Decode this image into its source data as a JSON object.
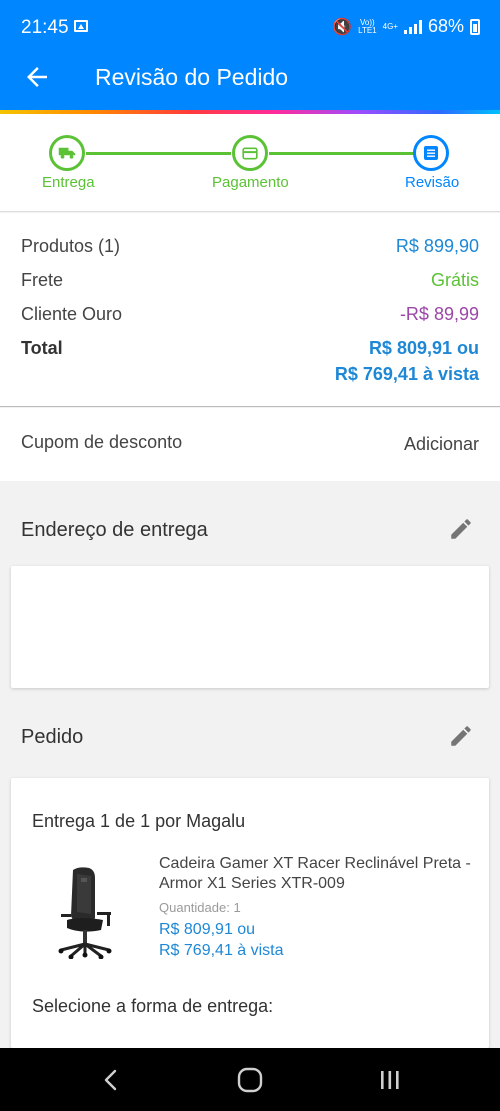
{
  "status_bar": {
    "time": "21:45",
    "network_top": "Vo))",
    "network_bottom": "LTE1",
    "network_gen": "4G+",
    "battery": "68%"
  },
  "header": {
    "title": "Revisão do Pedido",
    "back_icon": "arrow-left-icon"
  },
  "stepper": {
    "steps": [
      {
        "label": "Entrega",
        "icon": "truck-icon",
        "state": "done"
      },
      {
        "label": "Pagamento",
        "icon": "card-icon",
        "state": "done"
      },
      {
        "label": "Revisão",
        "icon": "list-icon",
        "state": "current"
      }
    ],
    "colors": {
      "done": "#5bc236",
      "current": "#0086ff"
    }
  },
  "summary": {
    "products_label": "Produtos (1)",
    "products_value": "R$ 899,90",
    "shipping_label": "Frete",
    "shipping_value": "Grátis",
    "gold_label": "Cliente Ouro",
    "gold_value": "-R$ 89,99",
    "total_label": "Total",
    "total_value_1": "R$ 809,91 ou",
    "total_value_2": "R$ 769,41 à vista"
  },
  "coupon": {
    "label": "Cupom de desconto",
    "action": "Adicionar"
  },
  "address": {
    "title": "Endereço de entrega"
  },
  "order": {
    "title": "Pedido",
    "delivery_title": "Entrega 1 de 1 por Magalu",
    "product_name": "Cadeira Gamer XT Racer Reclinável Preta - Armor X1 Series XTR-009",
    "quantity": "Quantidade:  1",
    "price_1": "R$ 809,91 ou",
    "price_2": "R$ 769,41 à vista",
    "choose_delivery": "Selecione a forma de entrega:"
  },
  "nav": {
    "back": "nav-back-icon",
    "home": "nav-home-icon",
    "recents": "nav-recents-icon"
  },
  "colors": {
    "brand_blue": "#0086ff",
    "price_blue": "#1e88d6",
    "green": "#5bc236",
    "purple": "#9c46a8"
  }
}
